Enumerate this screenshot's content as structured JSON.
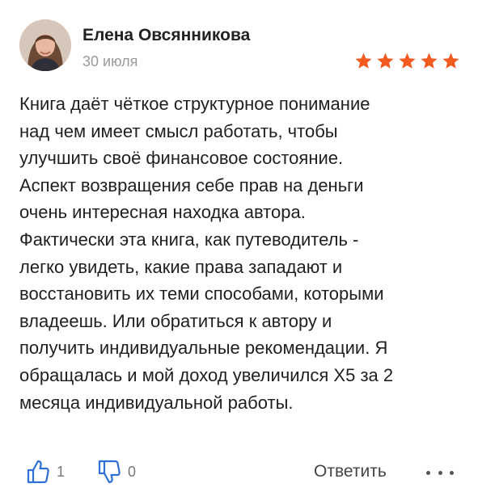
{
  "author": {
    "name": "Елена Овсянникова",
    "date": "30 июля",
    "avatar_icon": "user-photo"
  },
  "rating": {
    "value": 5,
    "max": 5,
    "star_color": "#f25a1f"
  },
  "review": {
    "text": "Книга даёт чёткое структурное понимание\nнад чем имеет смысл работать, чтобы\nулучшить своё финансовое состояние.\nАспект возвращения себе прав на деньги\nочень интересная находка автора.\nФактически эта книга, как путеводитель -\nлегко увидеть, какие права западают и\nвосстановить их теми способами, которыми\nвладеешь. Или обратиться к автору и\nполучить индивидуальные рекомендации. Я\nобращалась и мой доход увеличился Х5 за 2\nмесяца индивидуальной работы."
  },
  "actions": {
    "likes_count": "1",
    "dislikes_count": "0",
    "reply_label": "Ответить",
    "like_icon": "thumbs-up-icon",
    "dislike_icon": "thumbs-down-icon",
    "more_icon": "more-dots-icon",
    "accent_color": "#2f6fd6"
  }
}
